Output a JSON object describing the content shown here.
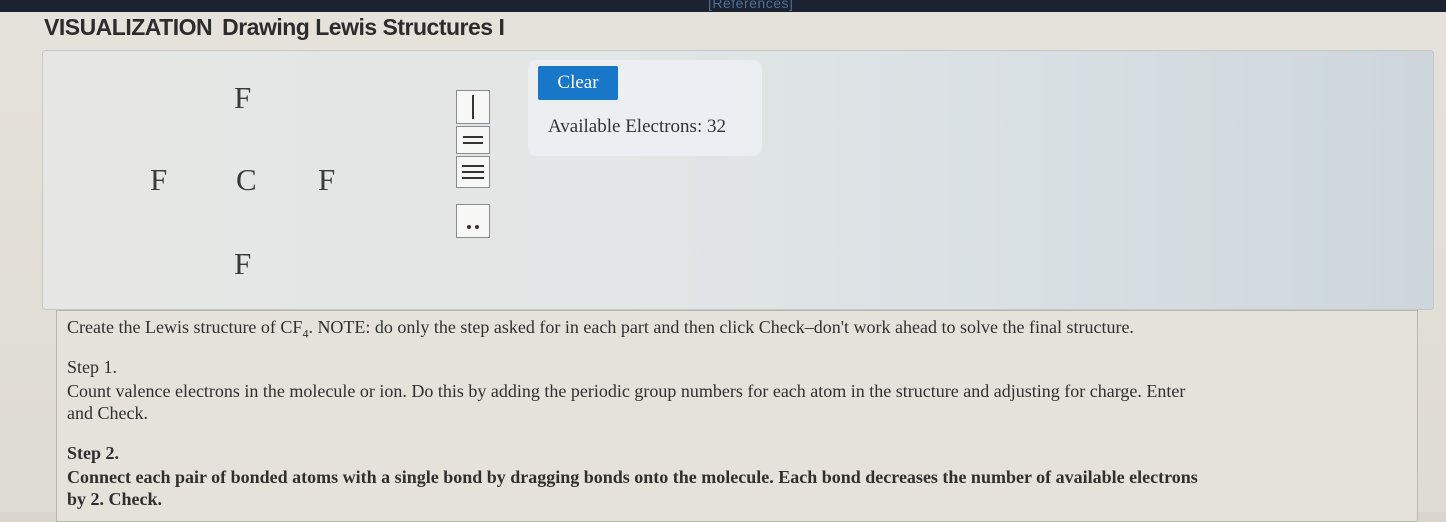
{
  "header": {
    "references_label": "[References]",
    "title_prefix": "VISUALIZATION",
    "title": "Drawing Lewis Structures I"
  },
  "molecule": {
    "atoms": [
      {
        "symbol": "F",
        "role": "top"
      },
      {
        "symbol": "F",
        "role": "left"
      },
      {
        "symbol": "C",
        "role": "center"
      },
      {
        "symbol": "F",
        "role": "right"
      },
      {
        "symbol": "F",
        "role": "bottom"
      }
    ]
  },
  "palette": {
    "items": [
      {
        "name": "single-bond",
        "icon": "single-bond-icon"
      },
      {
        "name": "double-bond",
        "icon": "double-bond-icon"
      },
      {
        "name": "triple-bond",
        "icon": "triple-bond-icon"
      },
      {
        "name": "lone-pair",
        "icon": "lone-pair-icon"
      }
    ]
  },
  "controls": {
    "clear_label": "Clear",
    "available_electrons_label": "Available Electrons: 32",
    "clear_color": "#1877c9"
  },
  "instructions": {
    "intro_a": "Create the Lewis structure of CF",
    "intro_sub": "4",
    "intro_b": ". NOTE: do only the step asked for in each part and then click Check–don't work ahead to solve the final structure.",
    "step1_title": "Step 1.",
    "step1_line1": "Count valence electrons in the molecule or ion. Do this by adding the periodic group numbers for each atom in the structure and adjusting for charge. Enter",
    "step1_line2": "and Check.",
    "step2_title": "Step 2.",
    "step2_line1": "Connect each pair of bonded atoms with a single bond by dragging bonds onto the molecule. Each bond decreases the number of available electrons",
    "step2_line2": "by 2. Check."
  }
}
